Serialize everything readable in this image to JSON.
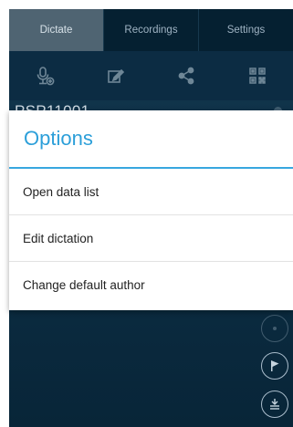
{
  "tabs": [
    {
      "label": "Dictate",
      "active": true
    },
    {
      "label": "Recordings",
      "active": false
    },
    {
      "label": "Settings",
      "active": false
    }
  ],
  "toolbar": {
    "icons": [
      "microphone-add-icon",
      "edit-icon",
      "share-icon",
      "qr-code-icon"
    ]
  },
  "device": {
    "name": "PSP11001"
  },
  "dialog": {
    "title": "Options",
    "options": [
      "Open data list",
      "Edit dictation",
      "Change default author"
    ]
  },
  "side_buttons": [
    "dot-icon",
    "flag-icon",
    "insert-icon"
  ],
  "colors": {
    "accent": "#2c9fd9",
    "background": "#0d2f45",
    "active_tab": "#4f6472"
  }
}
